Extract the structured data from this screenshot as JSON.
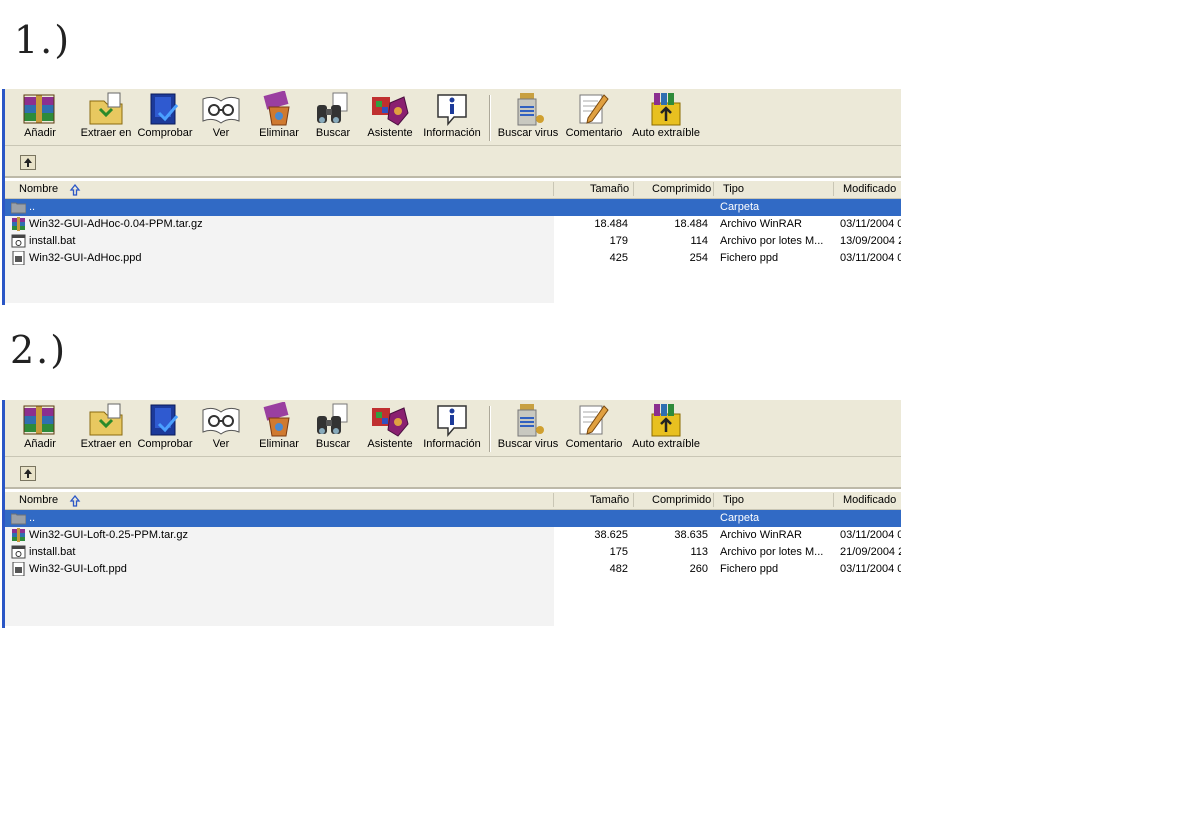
{
  "labels": {
    "first": "1.)",
    "second": "2.)"
  },
  "toolbar": {
    "buttons": [
      "Añadir",
      "Extraer en",
      "Comprobar",
      "Ver",
      "Eliminar",
      "Buscar",
      "Asistente",
      "Información",
      "Buscar virus",
      "Comentario",
      "Auto extraíble"
    ]
  },
  "columns": {
    "name": "Nombre",
    "size": "Tamaño",
    "packed": "Comprimido",
    "type": "Tipo",
    "modified": "Modificado"
  },
  "panels": [
    {
      "rows": [
        {
          "name": "..",
          "size": "",
          "packed": "",
          "type": "Carpeta",
          "modified": "",
          "icon": "folder-icon"
        },
        {
          "name": "Win32-GUI-AdHoc-0.04-PPM.tar.gz",
          "size": "18.484",
          "packed": "18.484",
          "type": "Archivo WinRAR",
          "modified": "03/11/2004 0",
          "icon": "rar-archive-icon"
        },
        {
          "name": "install.bat",
          "size": "179",
          "packed": "114",
          "type": "Archivo por lotes M...",
          "modified": "13/09/2004 2",
          "icon": "batch-file-icon"
        },
        {
          "name": "Win32-GUI-AdHoc.ppd",
          "size": "425",
          "packed": "254",
          "type": "Fichero ppd",
          "modified": "03/11/2004 0",
          "icon": "ppd-file-icon"
        }
      ]
    },
    {
      "rows": [
        {
          "name": "..",
          "size": "",
          "packed": "",
          "type": "Carpeta",
          "modified": "",
          "icon": "folder-icon"
        },
        {
          "name": "Win32-GUI-Loft-0.25-PPM.tar.gz",
          "size": "38.625",
          "packed": "38.635",
          "type": "Archivo WinRAR",
          "modified": "03/11/2004 0",
          "icon": "rar-archive-icon"
        },
        {
          "name": "install.bat",
          "size": "175",
          "packed": "113",
          "type": "Archivo por lotes M...",
          "modified": "21/09/2004 2",
          "icon": "batch-file-icon"
        },
        {
          "name": "Win32-GUI-Loft.ppd",
          "size": "482",
          "packed": "260",
          "type": "Fichero ppd",
          "modified": "03/11/2004 0",
          "icon": "ppd-file-icon"
        }
      ]
    }
  ],
  "colors": {
    "selection": "#316ac5",
    "toolbar": "#ece9d8",
    "accent": "#2a56c6"
  }
}
